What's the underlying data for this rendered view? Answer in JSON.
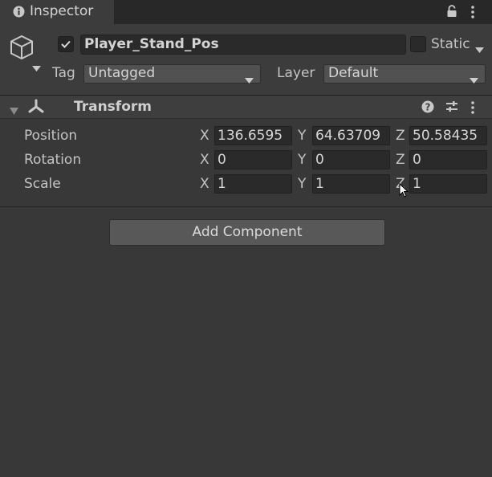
{
  "tab": {
    "title": "Inspector"
  },
  "header": {
    "name": "Player_Stand_Pos",
    "active": true,
    "static_label": "Static",
    "static": false,
    "tag_label": "Tag",
    "tag_value": "Untagged",
    "layer_label": "Layer",
    "layer_value": "Default"
  },
  "component": {
    "title": "Transform",
    "rows": [
      {
        "label": "Position",
        "x": "136.6595",
        "y": "64.63709",
        "z": "50.58435"
      },
      {
        "label": "Rotation",
        "x": "0",
        "y": "0",
        "z": "0"
      },
      {
        "label": "Scale",
        "x": "1",
        "y": "1",
        "z": "1"
      }
    ],
    "axes": {
      "x": "X",
      "y": "Y",
      "z": "Z"
    }
  },
  "add_component_label": "Add Component",
  "icons": [
    "info-icon",
    "lock-icon",
    "menu-icon",
    "gameobject-cube-icon",
    "check-icon",
    "chevron-down-icon",
    "foldout-arrow-icon",
    "transform-axes-icon",
    "help-icon",
    "preset-icon",
    "cursor-icon"
  ],
  "colors": {
    "background": "#383838",
    "field": "#2a2a2a",
    "button": "#585858"
  }
}
